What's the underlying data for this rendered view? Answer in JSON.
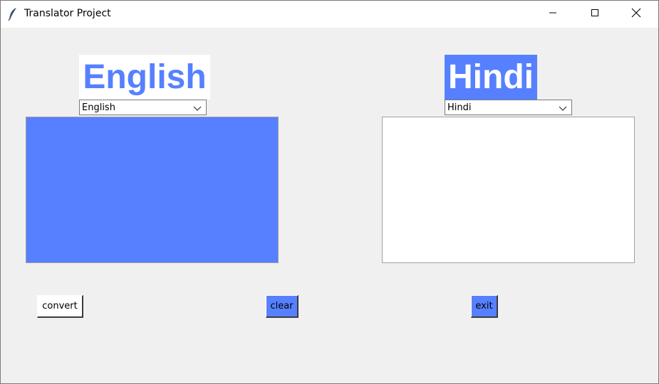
{
  "window": {
    "title": "Translator Project",
    "controls": [
      "minimize-icon",
      "maximize-icon",
      "close-icon"
    ]
  },
  "source": {
    "heading": "English",
    "language_select": {
      "selected": "English"
    },
    "text": ""
  },
  "target": {
    "heading": "Hindi",
    "language_select": {
      "selected": "Hindi"
    },
    "text": ""
  },
  "buttons": {
    "convert": "convert",
    "clear": "clear",
    "exit": "exit"
  },
  "colors": {
    "accent": "#5680ff",
    "window_bg": "#f0f0f0",
    "titlebar_bg": "#ffffff"
  }
}
